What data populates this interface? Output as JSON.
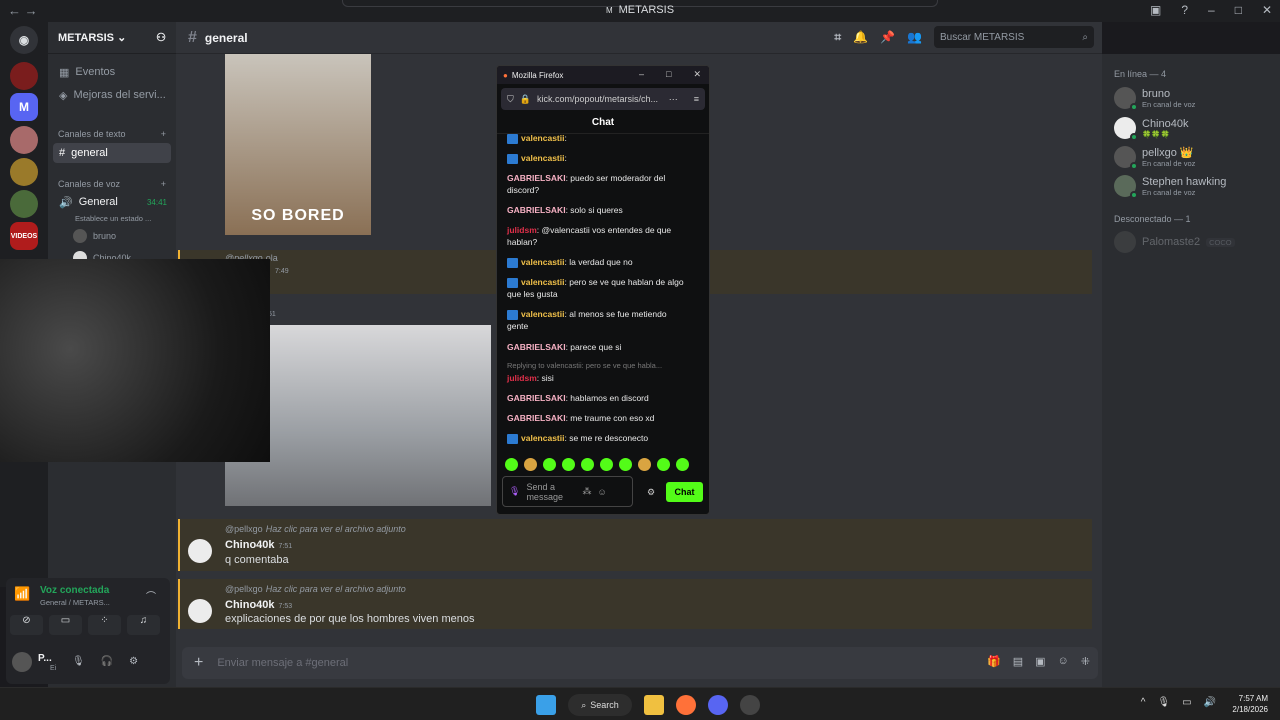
{
  "window": {
    "title": "METARSIS",
    "title_icon": "M"
  },
  "server": {
    "name": "METARSIS ⌄"
  },
  "nav": {
    "events": "Eventos",
    "boosts": "Mejoras del servi...",
    "text_cat": "Canales de texto",
    "text_channel": "general",
    "voice_cat": "Canales de voz",
    "voice_channel": "General",
    "voice_time": "34:41",
    "voice_status": "Establece un estado ...",
    "voice_user1": "bruno",
    "voice_user2": "Chino40k"
  },
  "header": {
    "channel": "general",
    "search_placeholder": "Buscar METARSIS"
  },
  "messages": {
    "m1_reply_user": "@pellxgo",
    "m1_reply_text": "ola",
    "m1_time": "7:49",
    "m2_time": "51",
    "m3_reply_user": "@pellxgo",
    "m3_reply_text": "Haz clic para ver el archivo adjunto",
    "m3_user": "Chino40k",
    "m3_time": "7:51",
    "m3_text": "q comentaba",
    "m4_reply_user": "@pellxgo",
    "m4_reply_text": "Haz clic para ver el archivo adjunto",
    "m4_user": "Chino40k",
    "m4_time": "7:53",
    "m4_text": "explicaciones de por que los hombres viven menos",
    "gif_caption": "SO BORED"
  },
  "composer": {
    "placeholder": "Enviar mensaje a #general"
  },
  "members": {
    "online_title": "En línea — 4",
    "online": [
      {
        "name": "bruno",
        "status": "En canal de voz"
      },
      {
        "name": "Chino40k",
        "status": "🍀🍀🍀"
      },
      {
        "name": "pellxgo 👑",
        "status": "En canal de voz"
      },
      {
        "name": "Stephen hawking",
        "status": "En canal de voz"
      }
    ],
    "offline_title": "Desconectado — 1",
    "offline": [
      {
        "name": "Palomaste2",
        "tag": "COCO"
      }
    ]
  },
  "voice_panel": {
    "title": "Voz conectada",
    "subtitle": "General / METARS...",
    "user": "P...",
    "user_sub": "Ei"
  },
  "firefox": {
    "title": "Mozilla Firefox",
    "url": "kick.com/popout/metarsis/ch...",
    "chat_title": "Chat",
    "lines": [
      {
        "user": "valencastii",
        "text": "",
        "kind": "v"
      },
      {
        "user": "valencastii",
        "text": "",
        "kind": "v"
      },
      {
        "user": "GABRIELSAKI",
        "text": "puedo ser moderador del discord?",
        "kind": "g"
      },
      {
        "user": "GABRIELSAKI",
        "text": "solo si queres",
        "kind": "g"
      },
      {
        "user": "julidsm",
        "text": "@valencastii vos entendes de que hablan?",
        "kind": "j"
      },
      {
        "user": "valencastii",
        "text": "la verdad que no",
        "kind": "v"
      },
      {
        "user": "valencastii",
        "text": "pero se ve que hablan de algo que les gusta",
        "kind": "v"
      },
      {
        "user": "valencastii",
        "text": "al menos se fue metiendo gente",
        "kind": "v"
      },
      {
        "user": "GABRIELSAKI",
        "text": "parece que si",
        "kind": "g"
      },
      {
        "user": "julidsm",
        "text": "sisi",
        "kind": "j"
      },
      {
        "user": "GABRIELSAKI",
        "text": "hablamos en discord",
        "kind": "g"
      },
      {
        "user": "GABRIELSAKI",
        "text": "me traume con eso xd",
        "kind": "g"
      },
      {
        "user": "valencastii",
        "text": "se me re desconecto",
        "kind": "v"
      }
    ],
    "reply_note": "Replying to valencastii: pero se ve que habla...",
    "input_placeholder": "Send a message",
    "send": "Chat"
  },
  "taskbar": {
    "search": "Search",
    "time": "7:57 AM",
    "date": "2/18/2026"
  },
  "colors": {
    "accent": "#53fc18",
    "discord": "#5865f2",
    "online": "#23a55a"
  }
}
